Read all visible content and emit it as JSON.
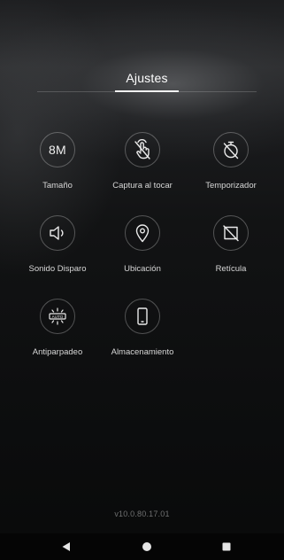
{
  "header": {
    "title": "Ajustes"
  },
  "settings": [
    {
      "label": "Tamaño",
      "icon": "size-8m-icon",
      "icon_text": "8M"
    },
    {
      "label": "Captura al tocar",
      "icon": "touch-capture-disabled-icon"
    },
    {
      "label": "Temporizador",
      "icon": "timer-disabled-icon"
    },
    {
      "label": "Sonido Disparo",
      "icon": "shutter-sound-icon"
    },
    {
      "label": "Ubicación",
      "icon": "location-pin-icon"
    },
    {
      "label": "Retícula",
      "icon": "grid-disabled-icon"
    },
    {
      "label": "Antiparpadeo",
      "icon": "anti-flicker-auto-icon",
      "icon_text": "AUTO"
    },
    {
      "label": "Almacenamiento",
      "icon": "phone-storage-icon"
    }
  ],
  "footer": {
    "version": "v10.0.80.17.01"
  },
  "nav": {
    "back_icon": "back-triangle-icon",
    "home_icon": "home-circle-icon",
    "recents_icon": "recents-square-icon"
  }
}
